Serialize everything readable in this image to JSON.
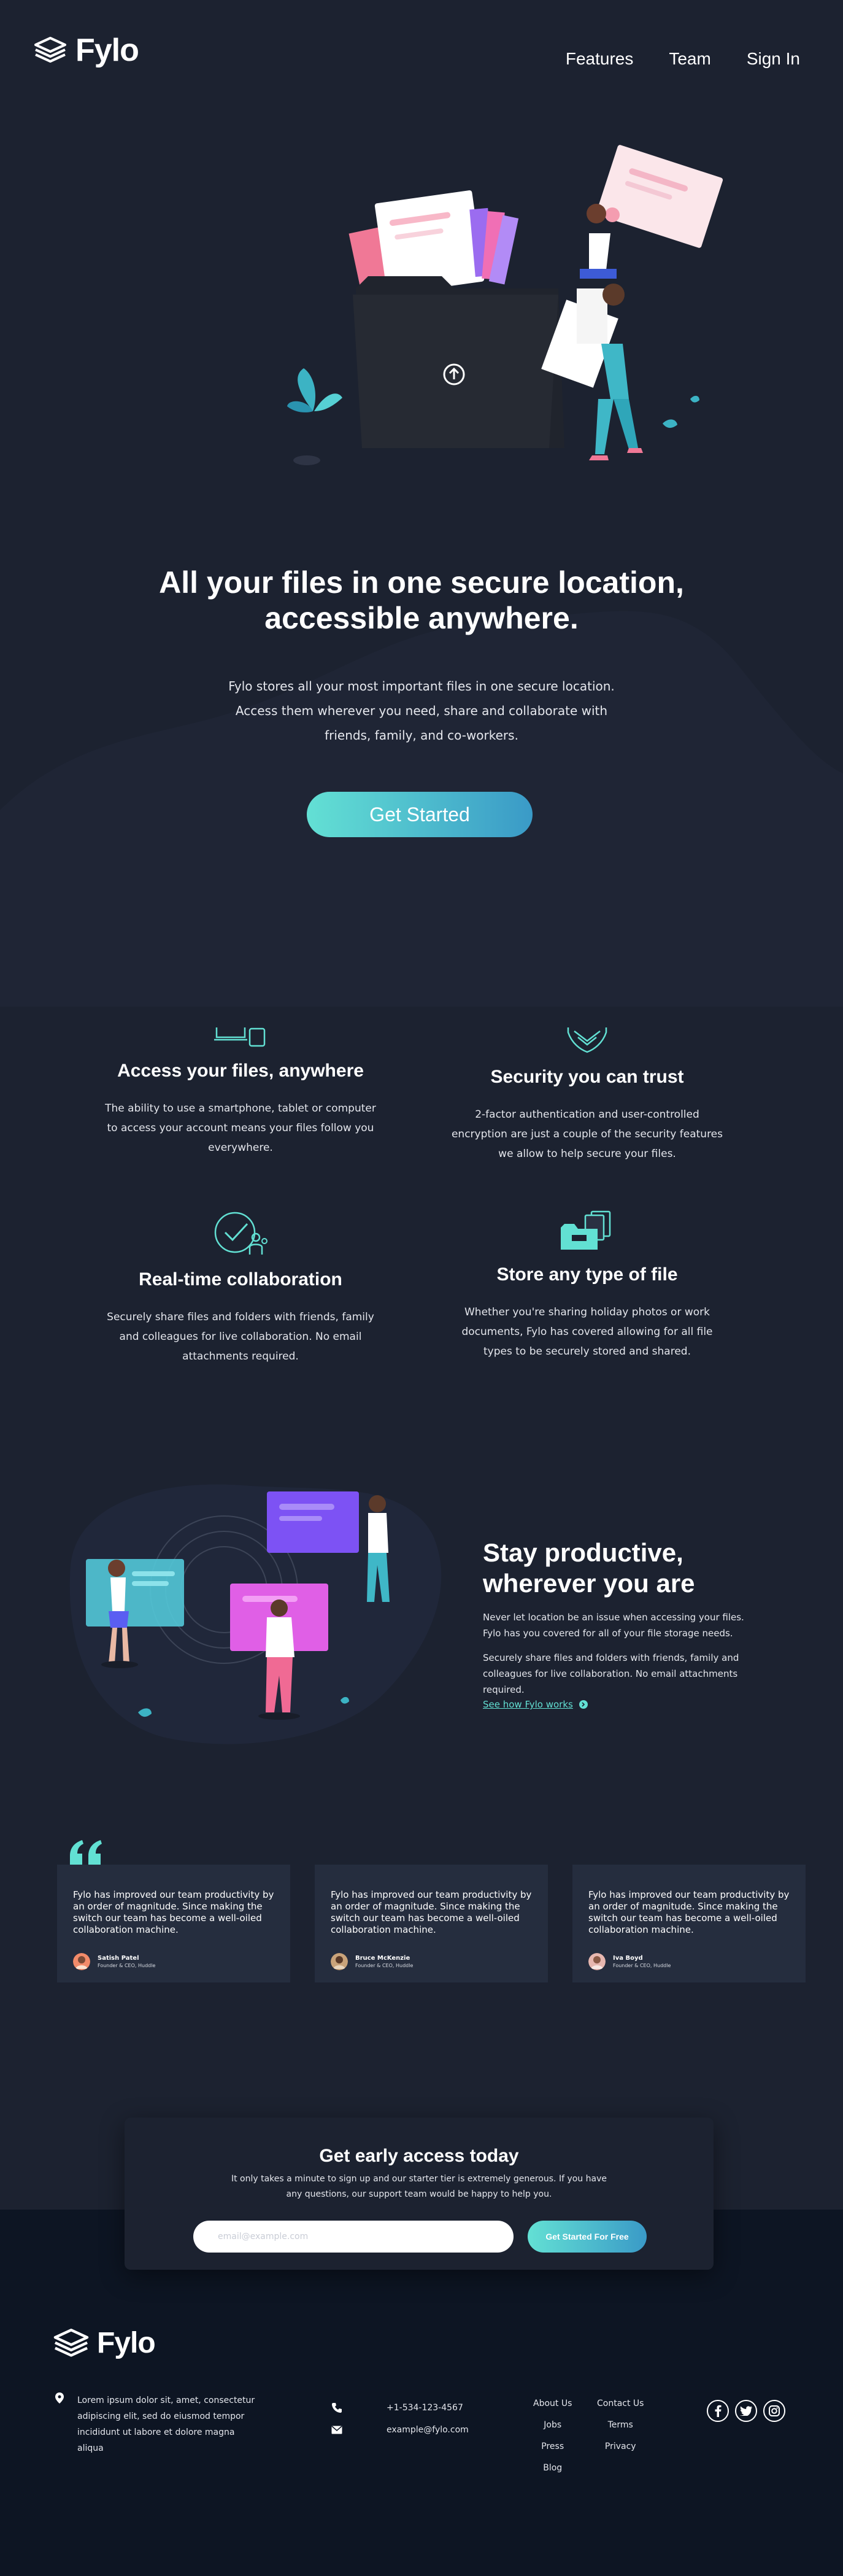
{
  "header": {
    "logo_text": "Fylo",
    "nav": [
      {
        "label": "Features"
      },
      {
        "label": "Team"
      },
      {
        "label": "Sign In"
      }
    ]
  },
  "hero": {
    "title": "All your files in one secure location, accessible anywhere.",
    "text": "Fylo stores all your most important files in one secure location. Access them wherever you need, share and collaborate with friends, family, and co-workers.",
    "cta_label": "Get Started"
  },
  "features": [
    {
      "icon": "devices-icon",
      "title": "Access your files, anywhere",
      "text": "The ability to use a smartphone, tablet or computer to access your account means your files follow you everywhere."
    },
    {
      "icon": "shield-icon",
      "title": "Security you can trust",
      "text": "2-factor authentication and user-controlled encryption are just a couple of the security features we allow to help secure your files."
    },
    {
      "icon": "collaboration-icon",
      "title": "Real-time collaboration",
      "text": "Securely share files and folders with friends, family and colleagues for live collaboration. No email attachments required."
    },
    {
      "icon": "folder-files-icon",
      "title": "Store any type of file",
      "text": "Whether you're sharing holiday photos or work documents, Fylo has covered allowing for all file types to be securely stored and shared."
    }
  ],
  "productive": {
    "title": "Stay productive, wherever you are",
    "paragraph_1": "Never let location be an issue when accessing your files. Fylo has you covered for all of your file storage needs.",
    "paragraph_2": "Securely share files and folders with friends, family and colleagues for live collaboration. No email attachments required.",
    "link_label": "See how Fylo works"
  },
  "testimonials": [
    {
      "text": "Fylo has improved our team productivity by an order of magnitude. Since making the switch our team has become a well-oiled collaboration machine.",
      "name": "Satish Patel",
      "role": "Founder & CEO, Huddle"
    },
    {
      "text": "Fylo has improved our team productivity by an order of magnitude. Since making the switch our team has become a well-oiled collaboration machine.",
      "name": "Bruce McKenzie",
      "role": "Founder & CEO, Huddle"
    },
    {
      "text": "Fylo has improved our team productivity by an order of magnitude. Since making the switch our team has become a well-oiled collaboration machine.",
      "name": "Iva Boyd",
      "role": "Founder & CEO, Huddle"
    }
  ],
  "cta": {
    "title": "Get early access today",
    "text": "It only takes a minute to sign up and our starter tier is extremely generous. If you have any questions, our support team would be happy to help you.",
    "email_placeholder": "email@example.com",
    "button_label": "Get Started For Free"
  },
  "footer": {
    "logo_text": "Fylo",
    "address": "Lorem ipsum dolor sit, amet, consectetur adipiscing elit, sed do eiusmod tempor incididunt ut labore et dolore magna aliqua",
    "phone": "+1-534-123-4567",
    "email": "example@fylo.com",
    "links_col_1": [
      {
        "label": "About Us"
      },
      {
        "label": "Jobs"
      },
      {
        "label": "Press"
      },
      {
        "label": "Blog"
      }
    ],
    "links_col_2": [
      {
        "label": "Contact Us"
      },
      {
        "label": "Terms"
      },
      {
        "label": "Privacy"
      }
    ],
    "socials": [
      "facebook-icon",
      "twitter-icon",
      "instagram-icon"
    ]
  },
  "colors": {
    "background": "#1c2230",
    "footer_background": "#0d1523",
    "card_background": "#252d3e",
    "accent_cyan": "#62e0d3",
    "accent_blue": "#3a9ac7"
  }
}
